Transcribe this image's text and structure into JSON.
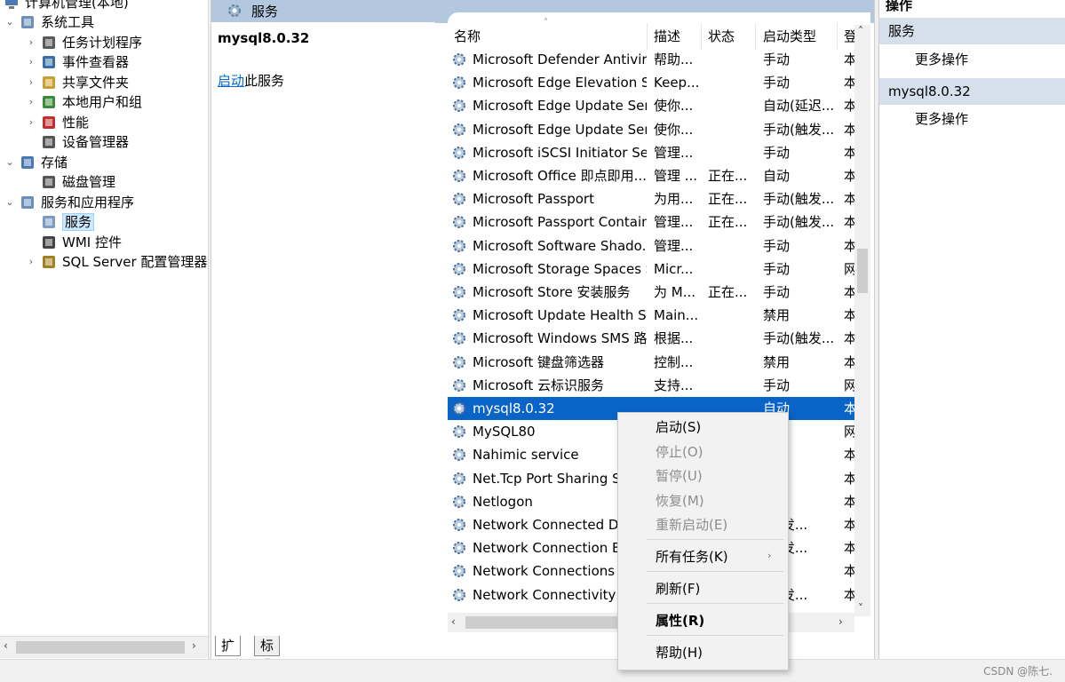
{
  "tree": {
    "root_label": "计算机管理(本地)",
    "items": [
      {
        "label": "系统工具",
        "expander": "⌄",
        "icon": "tools-icon"
      },
      {
        "label": "任务计划程序",
        "expander": "›",
        "icon": "clock-icon"
      },
      {
        "label": "事件查看器",
        "expander": "›",
        "icon": "event-viewer-icon"
      },
      {
        "label": "共享文件夹",
        "expander": "›",
        "icon": "shared-folder-icon"
      },
      {
        "label": "本地用户和组",
        "expander": "›",
        "icon": "users-icon"
      },
      {
        "label": "性能",
        "expander": "›",
        "icon": "performance-icon"
      },
      {
        "label": "设备管理器",
        "expander": "",
        "icon": "device-manager-icon"
      },
      {
        "label": "存储",
        "expander": "⌄",
        "icon": "storage-icon"
      },
      {
        "label": "磁盘管理",
        "expander": "",
        "icon": "disk-icon"
      },
      {
        "label": "服务和应用程序",
        "expander": "⌄",
        "icon": "services-apps-icon"
      },
      {
        "label": "服务",
        "expander": "",
        "icon": "gear-icon"
      },
      {
        "label": "WMI 控件",
        "expander": "",
        "icon": "wmi-icon"
      },
      {
        "label": "SQL Server 配置管理器",
        "expander": "›",
        "icon": "sql-server-icon"
      }
    ]
  },
  "middle": {
    "header_title": "服务",
    "selected_service": "mysql8.0.32",
    "action_link": "启动",
    "action_suffix": "此服务"
  },
  "columns": {
    "name": "名称",
    "desc": "描述",
    "status": "状态",
    "startup": "启动类型",
    "logon": "登"
  },
  "services": [
    {
      "name": "Microsoft Defender Antivir...",
      "desc": "帮助...",
      "status": "",
      "startup": "手动",
      "logon": "本"
    },
    {
      "name": "Microsoft Edge Elevation S...",
      "desc": "Keep...",
      "status": "",
      "startup": "手动",
      "logon": "本"
    },
    {
      "name": "Microsoft Edge Update Ser...",
      "desc": "使你...",
      "status": "",
      "startup": "自动(延迟...",
      "logon": "本"
    },
    {
      "name": "Microsoft Edge Update Ser...",
      "desc": "使你...",
      "status": "",
      "startup": "手动(触发...",
      "logon": "本"
    },
    {
      "name": "Microsoft iSCSI Initiator Ser...",
      "desc": "管理...",
      "status": "",
      "startup": "手动",
      "logon": "本"
    },
    {
      "name": "Microsoft Office 即点即用...",
      "desc": "管理 ...",
      "status": "正在...",
      "startup": "自动",
      "logon": "本"
    },
    {
      "name": "Microsoft Passport",
      "desc": "为用...",
      "status": "正在...",
      "startup": "手动(触发...",
      "logon": "本"
    },
    {
      "name": "Microsoft Passport Container",
      "desc": "管理...",
      "status": "正在...",
      "startup": "手动(触发...",
      "logon": "本"
    },
    {
      "name": "Microsoft Software Shado...",
      "desc": "管理...",
      "status": "",
      "startup": "手动",
      "logon": "本"
    },
    {
      "name": "Microsoft Storage Spaces S...",
      "desc": "Micr...",
      "status": "",
      "startup": "手动",
      "logon": "网"
    },
    {
      "name": "Microsoft Store 安装服务",
      "desc": "为 M...",
      "status": "正在...",
      "startup": "手动",
      "logon": "本"
    },
    {
      "name": "Microsoft Update Health S...",
      "desc": "Main...",
      "status": "",
      "startup": "禁用",
      "logon": "本"
    },
    {
      "name": "Microsoft Windows SMS 路...",
      "desc": "根据...",
      "status": "",
      "startup": "手动(触发...",
      "logon": "本"
    },
    {
      "name": "Microsoft 键盘筛选器",
      "desc": "控制...",
      "status": "",
      "startup": "禁用",
      "logon": "本"
    },
    {
      "name": "Microsoft 云标识服务",
      "desc": "支持...",
      "status": "",
      "startup": "手动",
      "logon": "网"
    },
    {
      "name": "mysql8.0.32",
      "desc": "",
      "status": "",
      "startup": "自动",
      "logon": "本"
    },
    {
      "name": "MySQL80",
      "desc": "",
      "status": "",
      "startup": "",
      "logon": "网"
    },
    {
      "name": "Nahimic service",
      "desc": "",
      "status": "",
      "startup": "",
      "logon": "本"
    },
    {
      "name": "Net.Tcp Port Sharing Se",
      "desc": "",
      "status": "",
      "startup": "",
      "logon": "本"
    },
    {
      "name": "Netlogon",
      "desc": "",
      "status": "",
      "startup": "",
      "logon": "本"
    },
    {
      "name": "Network Connected Dev",
      "desc": "",
      "status": "",
      "startup": "(触发...",
      "logon": "本"
    },
    {
      "name": "Network Connection Bro",
      "desc": "",
      "status": "",
      "startup": "(触发...",
      "logon": "本"
    },
    {
      "name": "Network Connections",
      "desc": "",
      "status": "",
      "startup": "",
      "logon": "本"
    },
    {
      "name": "Network Connectivity As",
      "desc": "",
      "status": "",
      "startup": "(触发...",
      "logon": "本"
    }
  ],
  "tabs": [
    "扩展",
    "标准"
  ],
  "actions": {
    "title": "操作",
    "section1": "服务",
    "section1_item": "更多操作",
    "section2": "mysql8.0.32",
    "section2_item": "更多操作"
  },
  "context_menu": {
    "start": "启动(S)",
    "stop": "停止(O)",
    "pause": "暂停(U)",
    "resume": "恢复(M)",
    "restart": "重新启动(E)",
    "all_tasks": "所有任务(K)",
    "refresh": "刷新(F)",
    "properties": "属性(R)",
    "help": "帮助(H)"
  },
  "status_bar": {
    "watermark": "CSDN @陈七."
  },
  "colors": {
    "selection": "#0a64c8",
    "header": "#b3c8df",
    "action_section": "#d6e0ec",
    "link": "#0066cc"
  }
}
